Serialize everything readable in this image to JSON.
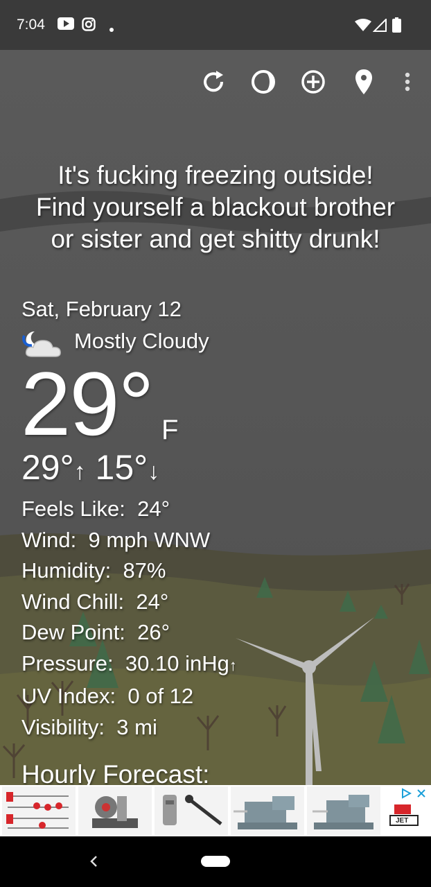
{
  "status_bar": {
    "time": "7:04",
    "left_icons": [
      "youtube-icon",
      "instagram-icon",
      "notification-dot"
    ],
    "right_icons": [
      "wifi-icon",
      "signal-icon",
      "battery-icon"
    ]
  },
  "toolbar": {
    "icons": [
      "refresh-icon",
      "theme-icon",
      "add-location-icon",
      "location-pin-icon",
      "more-options-icon"
    ]
  },
  "weather": {
    "headline_lines": [
      "It's fucking freezing outside!",
      "Find yourself a blackout brother",
      "or sister and get shitty drunk!"
    ],
    "date": "Sat, February 12",
    "condition": "Mostly Cloudy",
    "condition_icon": "partly-cloudy-night-icon",
    "temperature": "29°",
    "unit": "F",
    "high": "29°",
    "high_arrow": "↑",
    "low": "15°",
    "low_arrow": "↓",
    "details": [
      {
        "label": "Feels Like:",
        "value": "24°"
      },
      {
        "label": "Wind:",
        "value": "9 mph WNW"
      },
      {
        "label": "Humidity:",
        "value": "87%"
      },
      {
        "label": "Wind Chill:",
        "value": "24°"
      },
      {
        "label": "Dew Point:",
        "value": "26°"
      },
      {
        "label": "Pressure:",
        "value": "30.10 inHg",
        "trend": "↑"
      },
      {
        "label": "UV Index:",
        "value": "0 of 12"
      },
      {
        "label": "Visibility:",
        "value": "3 mi"
      }
    ],
    "hourly_heading": "Hourly Forecast:"
  },
  "ad": {
    "items": [
      "clamps-product",
      "belt-sander-product",
      "drill-chuck-product",
      "bench-vise-product",
      "bench-vise-2-product",
      "jet-logo"
    ],
    "brand": "JET",
    "close_icon": "close-icon",
    "adchoices_icon": "adchoices-icon"
  },
  "nav": {
    "back_icon": "back-icon",
    "home_icon": "home-pill-icon"
  },
  "colors": {
    "sky": "#555555",
    "hill": "#5c5a42",
    "text": "#ffffff",
    "accent_blue": "#1a73e8"
  }
}
